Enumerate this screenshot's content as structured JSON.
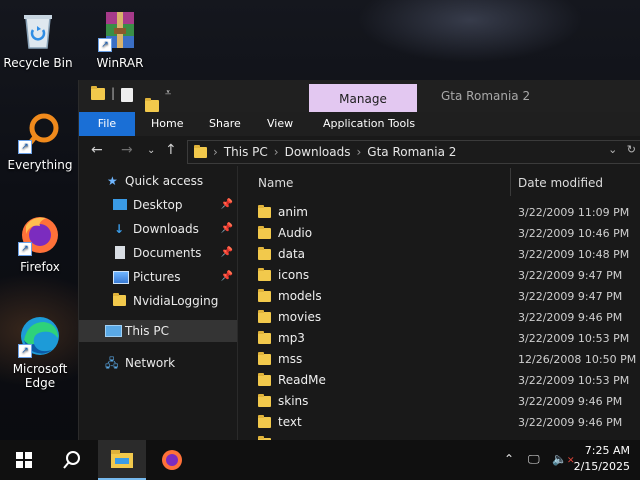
{
  "desktop": {
    "icons": [
      {
        "label": "Recycle Bin",
        "icon": "recycle-bin-icon"
      },
      {
        "label": "WinRAR",
        "icon": "winrar-icon"
      },
      {
        "label": "Everything",
        "icon": "everything-search-icon"
      },
      {
        "label": "Firefox",
        "icon": "firefox-icon"
      },
      {
        "label": "Microsoft Edge",
        "icon": "edge-icon"
      }
    ]
  },
  "window": {
    "title": "Gta Romania 2",
    "contextual_tab": "Manage",
    "ribbon_tabs": [
      "File",
      "Home",
      "Share",
      "View",
      "Application Tools"
    ],
    "breadcrumb": [
      "This PC",
      "Downloads",
      "Gta Romania 2"
    ],
    "columns": {
      "name": "Name",
      "date": "Date modified"
    },
    "nav": {
      "quick_access": "Quick access",
      "items": [
        {
          "label": "Desktop",
          "icon": "desktop-icon",
          "pinned": true
        },
        {
          "label": "Downloads",
          "icon": "downloads-icon",
          "pinned": true
        },
        {
          "label": "Documents",
          "icon": "documents-icon",
          "pinned": true
        },
        {
          "label": "Pictures",
          "icon": "pictures-icon",
          "pinned": true
        },
        {
          "label": "NvidiaLogging",
          "icon": "folder-icon",
          "pinned": false
        }
      ],
      "this_pc": "This PC",
      "network": "Network"
    },
    "files": [
      {
        "name": "anim",
        "date": "3/22/2009 11:09 PM"
      },
      {
        "name": "Audio",
        "date": "3/22/2009 10:46 PM"
      },
      {
        "name": "data",
        "date": "3/22/2009 10:48 PM"
      },
      {
        "name": "icons",
        "date": "3/22/2009 9:47 PM"
      },
      {
        "name": "models",
        "date": "3/22/2009 9:47 PM"
      },
      {
        "name": "movies",
        "date": "3/22/2009 9:46 PM"
      },
      {
        "name": "mp3",
        "date": "3/22/2009 10:53 PM"
      },
      {
        "name": "mss",
        "date": "12/26/2008 10:50 PM"
      },
      {
        "name": "ReadMe",
        "date": "3/22/2009 10:53 PM"
      },
      {
        "name": "skins",
        "date": "3/22/2009 9:46 PM"
      },
      {
        "name": "text",
        "date": "3/22/2009 9:46 PM"
      }
    ]
  },
  "taskbar": {
    "time": "7:25 AM",
    "date": "2/15/2025"
  },
  "colors": {
    "accent": "#1a6fd6",
    "manage_tab": "#e3c8f1",
    "folder": "#f2c94c"
  }
}
